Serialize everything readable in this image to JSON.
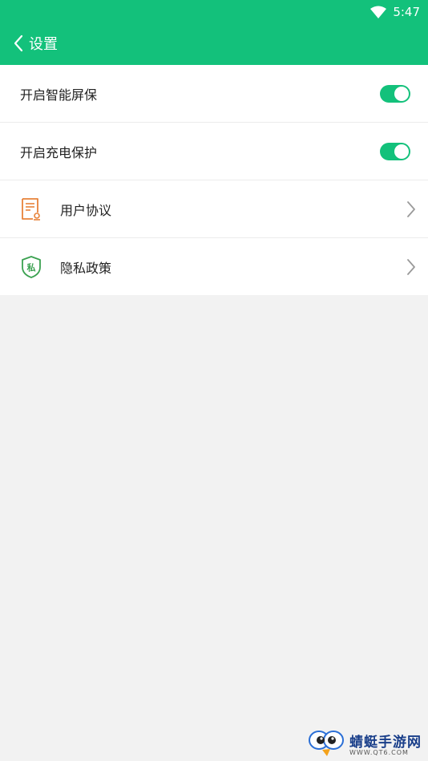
{
  "status_bar": {
    "time": "5:47",
    "wifi_icon": "wifi-icon"
  },
  "header": {
    "back_icon": "chevron-left-icon",
    "title": "设置"
  },
  "settings": {
    "smart_screensaver": {
      "label": "开启智能屏保",
      "enabled": true
    },
    "charging_protection": {
      "label": "开启充电保护",
      "enabled": true
    },
    "user_agreement": {
      "label": "用户协议",
      "icon": "document-icon"
    },
    "privacy_policy": {
      "label": "隐私政策",
      "icon": "privacy-shield-icon",
      "icon_glyph": "私"
    }
  },
  "watermark": {
    "name": "蜻蜓手游网",
    "url": "WWW.QT6.COM"
  },
  "colors": {
    "accent": "#13c17b",
    "document_icon": "#e8823a",
    "privacy_icon": "#3aa150"
  }
}
